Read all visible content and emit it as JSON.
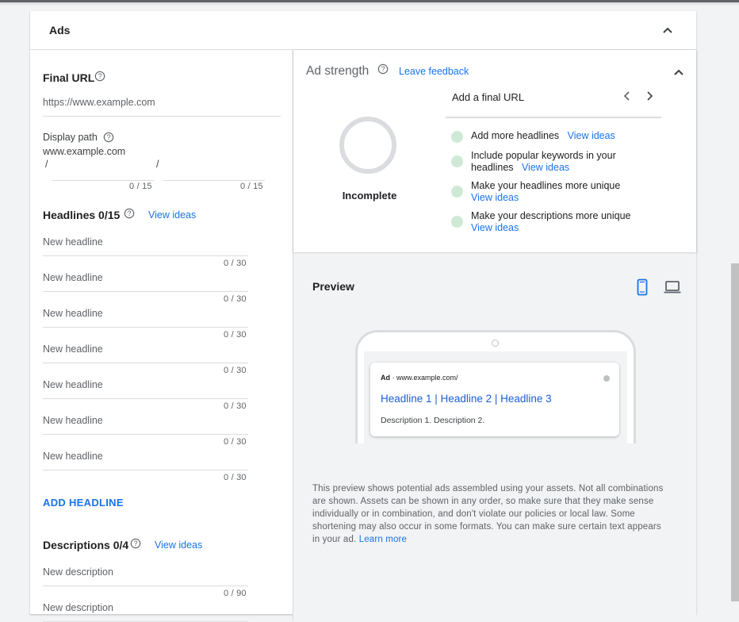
{
  "section": {
    "title": "Ads"
  },
  "final_url": {
    "label": "Final URL",
    "placeholder": "https://www.example.com"
  },
  "display_path": {
    "label": "Display path",
    "domain": "www.example.com",
    "slash": "/",
    "path1_count": "0 / 15",
    "path2_count": "0 / 15"
  },
  "headlines": {
    "label": "Headlines 0/15",
    "view_ideas": "View ideas",
    "placeholder": "New headline",
    "counter": "0 / 30",
    "add_label": "ADD HEADLINE"
  },
  "descriptions": {
    "label": "Descriptions 0/4",
    "view_ideas": "View ideas",
    "placeholder": "New description",
    "counter": "0 / 90"
  },
  "ad_strength": {
    "title": "Ad strength",
    "feedback": "Leave feedback",
    "status": "Incomplete",
    "carousel_text": "Add a final URL",
    "tips": [
      {
        "text": "Add more headlines",
        "link": "View ideas"
      },
      {
        "text": "Include popular keywords in your headlines",
        "link": "View ideas"
      },
      {
        "text": "Make your headlines more unique",
        "link": "View ideas"
      },
      {
        "text": "Make your descriptions more unique",
        "link": "View ideas"
      }
    ]
  },
  "preview": {
    "title": "Preview",
    "ad_badge": "Ad",
    "ad_url": "www.example.com/",
    "headline": "Headline 1 | Headline 2 | Headline 3",
    "description": "Description 1. Description 2.",
    "disclaimer": "This preview shows potential ads assembled using your assets. Not all combinations are shown. Assets can be shown in any order, so make sure that they make sense individually or in combination, and don't violate our policies or local law. Some shortening may also occur in some formats. You can make sure certain text appears in your ad.",
    "learn_more": "Learn more"
  },
  "colors": {
    "accent": "#1a73e8",
    "tip_dot": "#ceead6",
    "border": "#dadce0"
  }
}
